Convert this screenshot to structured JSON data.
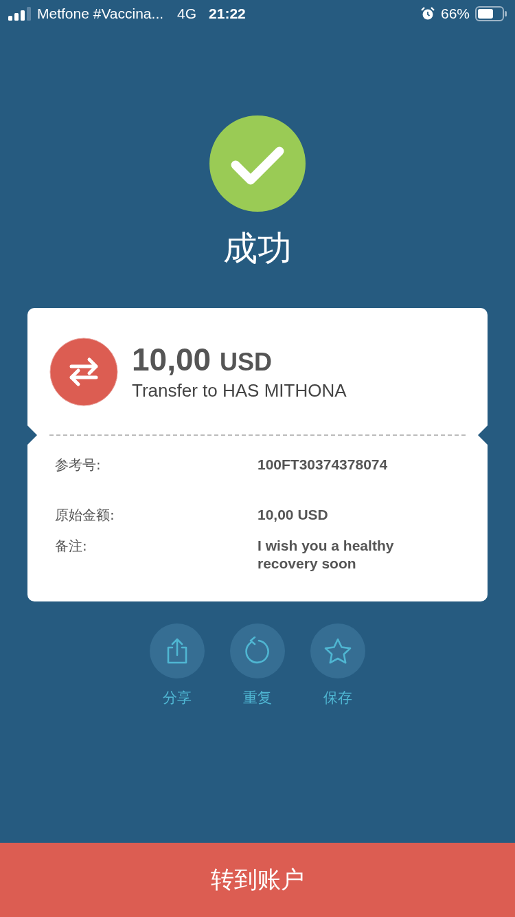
{
  "status_bar": {
    "carrier": "Metfone #Vaccina...",
    "network": "4G",
    "time": "21:22",
    "battery": "66%"
  },
  "title": "成功",
  "transfer": {
    "amount": "10,00",
    "currency": "USD",
    "description": "Transfer to HAS MITHONA"
  },
  "details": [
    {
      "label": "参考号:",
      "value": "100FT30374378074"
    },
    {
      "label": "原始金额:",
      "value": "10,00 USD"
    },
    {
      "label": "备注:",
      "value": "I wish you a healthy recovery soon"
    }
  ],
  "actions": [
    {
      "kind": "share",
      "label": "分享"
    },
    {
      "kind": "repeat",
      "label": "重复"
    },
    {
      "kind": "save",
      "label": "保存"
    }
  ],
  "primary_button": "转到账户"
}
